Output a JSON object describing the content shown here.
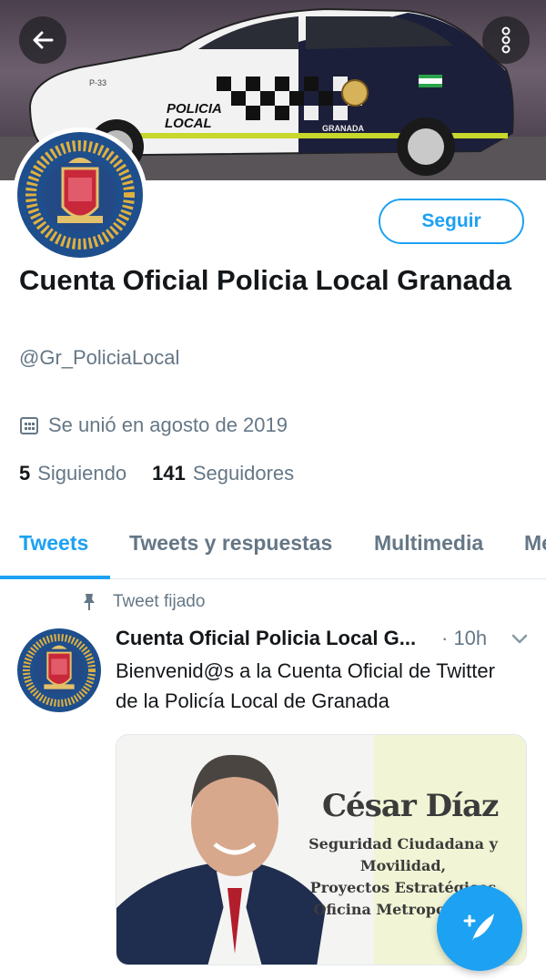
{
  "profile": {
    "display_name": "Cuenta Oficial Policia Local Granada",
    "handle": "@Gr_PoliciaLocal",
    "joined": "Se unió en agosto de 2019",
    "following_count": "5",
    "following_label": "Siguiendo",
    "followers_count": "141",
    "followers_label": "Seguidores",
    "follow_button": "Seguir"
  },
  "banner": {
    "car_text_line1": "POLICIA",
    "car_text_line2": "LOCAL",
    "car_text_city": "GRANADA",
    "car_plate": "P-33"
  },
  "tabs": [
    {
      "label": "Tweets",
      "active": true
    },
    {
      "label": "Tweets y respuestas",
      "active": false
    },
    {
      "label": "Multimedia",
      "active": false
    },
    {
      "label": "Me",
      "active": false
    }
  ],
  "tweet": {
    "pinned_label": "Tweet fijado",
    "author": "Cuenta Oficial Policia Local G...",
    "time": "· 10h",
    "text": "Bienvenid@s a la Cuenta Oficial de Twitter de la Policía Local de Granada",
    "media": {
      "name": "César Díaz",
      "line1": "Seguridad Ciudadana y",
      "line2": "Movilidad,",
      "line3": "Proyectos Estratégicos",
      "line4": "Oficina Metropolitana"
    }
  },
  "icons": {
    "back": "arrow-left-icon",
    "more": "more-vertical-icon",
    "calendar": "calendar-icon",
    "pin": "pin-icon",
    "chevron": "chevron-down-icon",
    "compose": "compose-tweet-icon"
  },
  "colors": {
    "accent": "#1da1f2",
    "secondary_text": "#657786",
    "primary_text": "#14171a"
  }
}
